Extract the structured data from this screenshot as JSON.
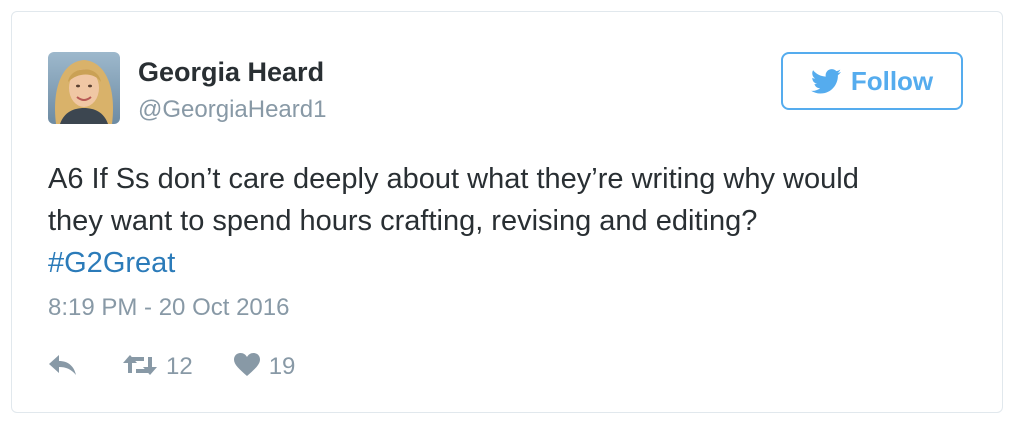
{
  "colors": {
    "name": "#292f33",
    "secondary": "#8899a6",
    "accent": "#55acee",
    "hashtag": "#2b7bb9",
    "border": "#e1e8ed"
  },
  "author": {
    "name": "Georgia Heard",
    "handle": "@GeorgiaHeard1",
    "avatar_icon": "avatar-photo"
  },
  "follow_button": {
    "icon": "twitter-bird-icon",
    "label": "Follow"
  },
  "tweet": {
    "text_line1": "A6 If Ss don’t care deeply about what they’re writing why would",
    "text_line2": "they want to spend hours crafting, revising and editing?",
    "hashtag": "#G2Great",
    "timestamp": "8:19 PM - 20 Oct 2016"
  },
  "actions": {
    "reply": {
      "icon": "reply-icon"
    },
    "retweet": {
      "icon": "retweet-icon",
      "count": "12"
    },
    "like": {
      "icon": "heart-icon",
      "count": "19"
    }
  }
}
